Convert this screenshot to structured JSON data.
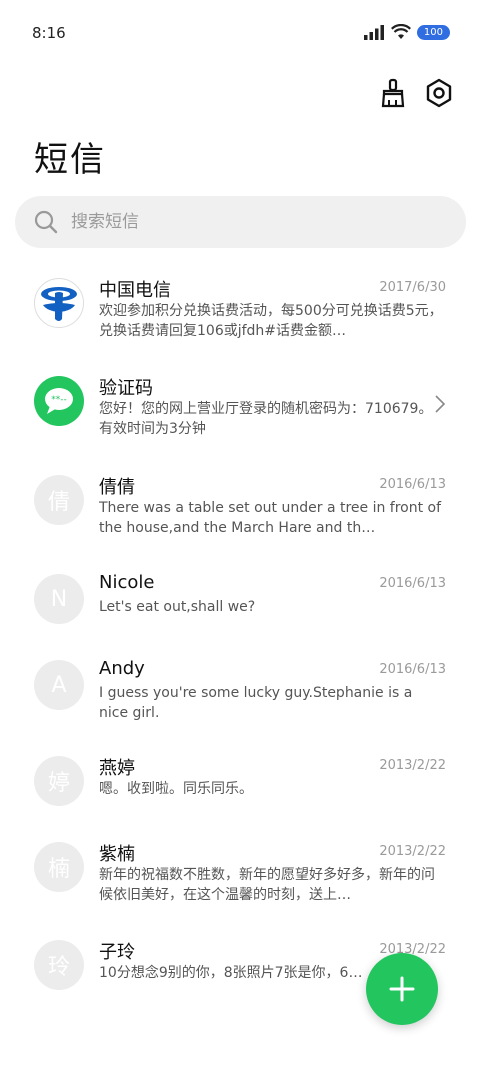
{
  "status_bar": {
    "time": "8:16",
    "battery": "100"
  },
  "toolbar": {
    "clean_icon": "broom-icon",
    "settings_icon": "gear-icon"
  },
  "page": {
    "title": "短信"
  },
  "search": {
    "placeholder": "搜索短信"
  },
  "messages": [
    {
      "name": "中国电信",
      "date": "2017/6/30",
      "preview": "欢迎参加积分兑换话费活动，每500分可兑换话费5元，兑换话费请回复106或jfdh#话费金额…",
      "avatar_type": "logo-telecom"
    },
    {
      "name": "验证码",
      "date": "",
      "preview": "您好！您的网上营业厅登录的随机密码为：710679。有效时间为3分钟",
      "avatar_type": "verification-icon"
    },
    {
      "name": "倩倩",
      "date": "2016/6/13",
      "preview": "There was a table set out under a tree in front of the house,and the March Hare and th…",
      "avatar_letter": "倩"
    },
    {
      "name": "Nicole",
      "date": "2016/6/13",
      "preview": "Let's eat out,shall we?",
      "avatar_letter": "N"
    },
    {
      "name": "Andy",
      "date": "2016/6/13",
      "preview": "I guess you're some lucky guy.Stephanie is a nice girl.",
      "avatar_letter": "A"
    },
    {
      "name": "燕婷",
      "date": "2013/2/22",
      "preview": "嗯。收到啦。同乐同乐。",
      "avatar_letter": "婷"
    },
    {
      "name": "紫楠",
      "date": "2013/2/22",
      "preview": "新年的祝福数不胜数，新年的愿望好多好多，新年的问候依旧美好，在这个温馨的时刻，送上…",
      "avatar_letter": "楠"
    },
    {
      "name": "子玲",
      "date": "2013/2/22",
      "preview": "10分想念9别的你，8张照片7张是你，6…",
      "avatar_letter": "玲"
    }
  ],
  "fab": {
    "icon": "plus-icon"
  }
}
